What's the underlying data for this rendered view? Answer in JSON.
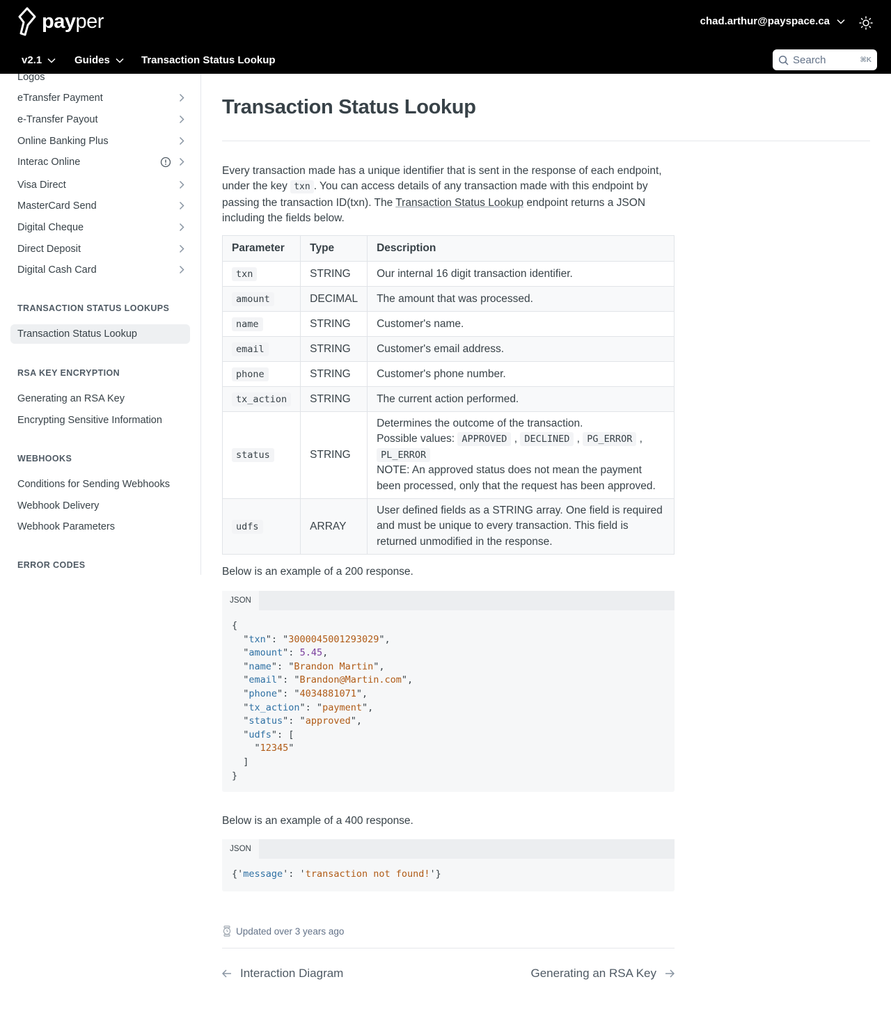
{
  "header": {
    "logo_text_bold": "pay",
    "logo_text_light": "per",
    "user_email": "chad.arthur@payspace.ca",
    "version_label": "v2.1",
    "guides_label": "Guides",
    "page_label": "Transaction Status Lookup",
    "search_placeholder": "Search",
    "search_shortcut": "⌘K"
  },
  "sidebar": {
    "items": [
      {
        "label": "Logos"
      },
      {
        "label": "eTransfer Payment"
      },
      {
        "label": "e-Transfer Payout"
      },
      {
        "label": "Online Banking Plus"
      },
      {
        "label": "Interac Online"
      },
      {
        "label": "Visa Direct"
      },
      {
        "label": "MasterCard Send"
      },
      {
        "label": "Digital Cheque"
      },
      {
        "label": "Direct Deposit"
      },
      {
        "label": "Digital Cash Card"
      }
    ],
    "section_tsl": "TRANSACTION STATUS LOOKUPS",
    "tsl_items": [
      {
        "label": "Transaction Status Lookup"
      }
    ],
    "section_rsa": "RSA KEY ENCRYPTION",
    "rsa_items": [
      {
        "label": "Generating an RSA Key"
      },
      {
        "label": "Encrypting Sensitive Information"
      }
    ],
    "section_webhooks": "WEBHOOKS",
    "webhook_items": [
      {
        "label": "Conditions for Sending Webhooks"
      },
      {
        "label": "Webhook Delivery"
      },
      {
        "label": "Webhook Parameters"
      }
    ],
    "section_errors": "ERROR CODES"
  },
  "main": {
    "title": "Transaction Status Lookup",
    "intro_1": "Every transaction made has a unique identifier that is sent in the response of each endpoint, under the key ",
    "intro_code": "txn",
    "intro_2": ". You can access details of any transaction made with this endpoint by passing the transaction ID(txn). The ",
    "intro_link": "Transaction Status Lookup",
    "intro_3": " endpoint returns a JSON including the fields below.",
    "table": {
      "headers": [
        "Parameter",
        "Type",
        "Description"
      ],
      "rows": [
        {
          "param": "txn",
          "type": "STRING",
          "desc": "Our internal 16 digit transaction identifier."
        },
        {
          "param": "amount",
          "type": "DECIMAL",
          "desc": "The amount that was processed."
        },
        {
          "param": "name",
          "type": "STRING",
          "desc": "Customer's name."
        },
        {
          "param": "email",
          "type": "STRING",
          "desc": "Customer's email address."
        },
        {
          "param": "phone",
          "type": "STRING",
          "desc": "Customer's phone number."
        },
        {
          "param": "tx_action",
          "type": "STRING",
          "desc": "The current action performed."
        },
        {
          "param": "status",
          "type": "STRING",
          "desc_1": "Determines the outcome of the transaction.",
          "desc_2": "Possible values:",
          "values": [
            "APPROVED",
            "DECLINED",
            "PG_ERROR",
            "PL_ERROR"
          ],
          "desc_3": "NOTE: An approved status does not mean the payment been processed, only that the request has been approved."
        },
        {
          "param": "udfs",
          "type": "ARRAY",
          "desc": "User defined fields as a STRING array. One field is required and must be unique to every transaction. This field is returned unmodified in the response."
        }
      ]
    },
    "example_200_label": "Below is an example of a 200 response.",
    "example_400_label": "Below is an example of a 400 response.",
    "code_tab": "JSON",
    "response_200": {
      "txn": "3000045001293029",
      "amount": "5.45",
      "name": "Brandon Martin",
      "email": "Brandon@Martin.com",
      "phone": "4034881071",
      "tx_action": "payment",
      "status": "approved",
      "udfs": [
        "12345"
      ]
    },
    "response_400": {
      "message": "transaction not found!"
    },
    "updated": "Updated over 3 years ago",
    "prev_label": "Interaction Diagram",
    "next_label": "Generating an RSA Key"
  }
}
